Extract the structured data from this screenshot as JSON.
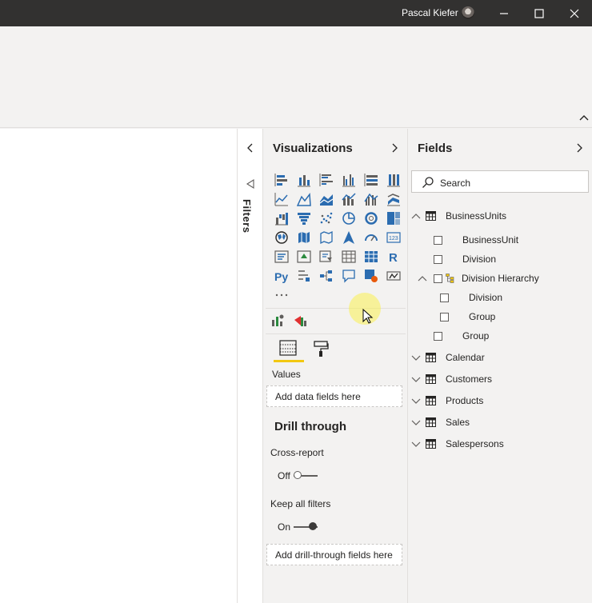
{
  "titlebar": {
    "user_name": "Pascal Kiefer",
    "minimize_icon": "minimize-icon",
    "maximize_icon": "maximize-icon",
    "close_icon": "close-icon"
  },
  "filters_pane": {
    "label": "Filters"
  },
  "visualizations": {
    "title": "Visualizations",
    "more": "...",
    "values_label": "Values",
    "values_placeholder": "Add data fields here",
    "drill_through_title": "Drill through",
    "cross_report_label": "Cross-report",
    "cross_report_state": "Off",
    "keep_filters_label": "Keep all filters",
    "keep_filters_state": "On",
    "drill_placeholder": "Add drill-through fields here"
  },
  "fields": {
    "title": "Fields",
    "search_placeholder": "Search",
    "tables": [
      {
        "name": "BusinessUnits",
        "children": [
          {
            "name": "BusinessUnit"
          },
          {
            "name": "Division"
          },
          {
            "name": "Division Hierarchy",
            "children": [
              {
                "name": "Division"
              },
              {
                "name": "Group"
              }
            ]
          },
          {
            "name": "Group"
          }
        ]
      },
      {
        "name": "Calendar"
      },
      {
        "name": "Customers"
      },
      {
        "name": "Products"
      },
      {
        "name": "Sales"
      },
      {
        "name": "Salespersons"
      }
    ]
  },
  "colors": {
    "accent": "#f2c811",
    "icon_blue": "#2b6cb0",
    "titlebar": "#323130"
  }
}
